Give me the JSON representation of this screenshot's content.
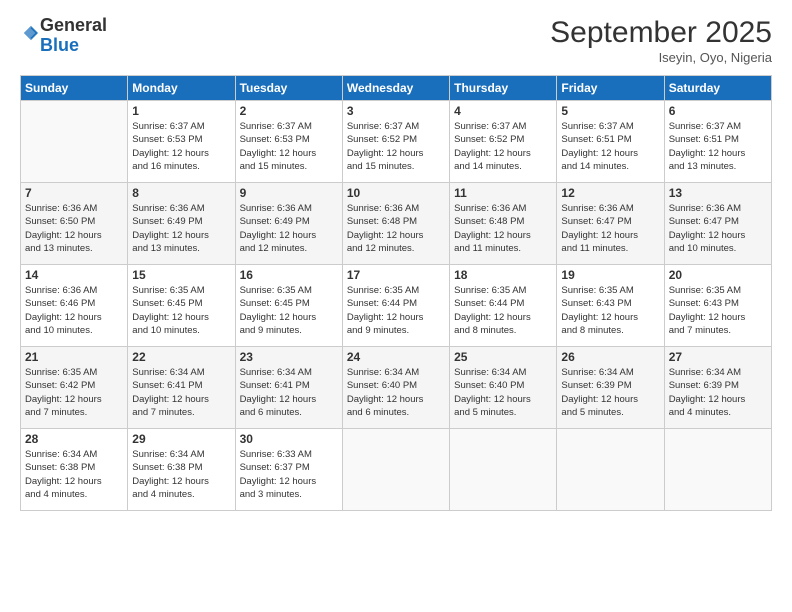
{
  "logo": {
    "general": "General",
    "blue": "Blue"
  },
  "header": {
    "month": "September 2025",
    "location": "Iseyin, Oyo, Nigeria"
  },
  "weekdays": [
    "Sunday",
    "Monday",
    "Tuesday",
    "Wednesday",
    "Thursday",
    "Friday",
    "Saturday"
  ],
  "weeks": [
    [
      {
        "day": "",
        "info": ""
      },
      {
        "day": "1",
        "info": "Sunrise: 6:37 AM\nSunset: 6:53 PM\nDaylight: 12 hours\nand 16 minutes."
      },
      {
        "day": "2",
        "info": "Sunrise: 6:37 AM\nSunset: 6:53 PM\nDaylight: 12 hours\nand 15 minutes."
      },
      {
        "day": "3",
        "info": "Sunrise: 6:37 AM\nSunset: 6:52 PM\nDaylight: 12 hours\nand 15 minutes."
      },
      {
        "day": "4",
        "info": "Sunrise: 6:37 AM\nSunset: 6:52 PM\nDaylight: 12 hours\nand 14 minutes."
      },
      {
        "day": "5",
        "info": "Sunrise: 6:37 AM\nSunset: 6:51 PM\nDaylight: 12 hours\nand 14 minutes."
      },
      {
        "day": "6",
        "info": "Sunrise: 6:37 AM\nSunset: 6:51 PM\nDaylight: 12 hours\nand 13 minutes."
      }
    ],
    [
      {
        "day": "7",
        "info": "Sunrise: 6:36 AM\nSunset: 6:50 PM\nDaylight: 12 hours\nand 13 minutes."
      },
      {
        "day": "8",
        "info": "Sunrise: 6:36 AM\nSunset: 6:49 PM\nDaylight: 12 hours\nand 13 minutes."
      },
      {
        "day": "9",
        "info": "Sunrise: 6:36 AM\nSunset: 6:49 PM\nDaylight: 12 hours\nand 12 minutes."
      },
      {
        "day": "10",
        "info": "Sunrise: 6:36 AM\nSunset: 6:48 PM\nDaylight: 12 hours\nand 12 minutes."
      },
      {
        "day": "11",
        "info": "Sunrise: 6:36 AM\nSunset: 6:48 PM\nDaylight: 12 hours\nand 11 minutes."
      },
      {
        "day": "12",
        "info": "Sunrise: 6:36 AM\nSunset: 6:47 PM\nDaylight: 12 hours\nand 11 minutes."
      },
      {
        "day": "13",
        "info": "Sunrise: 6:36 AM\nSunset: 6:47 PM\nDaylight: 12 hours\nand 10 minutes."
      }
    ],
    [
      {
        "day": "14",
        "info": "Sunrise: 6:36 AM\nSunset: 6:46 PM\nDaylight: 12 hours\nand 10 minutes."
      },
      {
        "day": "15",
        "info": "Sunrise: 6:35 AM\nSunset: 6:45 PM\nDaylight: 12 hours\nand 10 minutes."
      },
      {
        "day": "16",
        "info": "Sunrise: 6:35 AM\nSunset: 6:45 PM\nDaylight: 12 hours\nand 9 minutes."
      },
      {
        "day": "17",
        "info": "Sunrise: 6:35 AM\nSunset: 6:44 PM\nDaylight: 12 hours\nand 9 minutes."
      },
      {
        "day": "18",
        "info": "Sunrise: 6:35 AM\nSunset: 6:44 PM\nDaylight: 12 hours\nand 8 minutes."
      },
      {
        "day": "19",
        "info": "Sunrise: 6:35 AM\nSunset: 6:43 PM\nDaylight: 12 hours\nand 8 minutes."
      },
      {
        "day": "20",
        "info": "Sunrise: 6:35 AM\nSunset: 6:43 PM\nDaylight: 12 hours\nand 7 minutes."
      }
    ],
    [
      {
        "day": "21",
        "info": "Sunrise: 6:35 AM\nSunset: 6:42 PM\nDaylight: 12 hours\nand 7 minutes."
      },
      {
        "day": "22",
        "info": "Sunrise: 6:34 AM\nSunset: 6:41 PM\nDaylight: 12 hours\nand 7 minutes."
      },
      {
        "day": "23",
        "info": "Sunrise: 6:34 AM\nSunset: 6:41 PM\nDaylight: 12 hours\nand 6 minutes."
      },
      {
        "day": "24",
        "info": "Sunrise: 6:34 AM\nSunset: 6:40 PM\nDaylight: 12 hours\nand 6 minutes."
      },
      {
        "day": "25",
        "info": "Sunrise: 6:34 AM\nSunset: 6:40 PM\nDaylight: 12 hours\nand 5 minutes."
      },
      {
        "day": "26",
        "info": "Sunrise: 6:34 AM\nSunset: 6:39 PM\nDaylight: 12 hours\nand 5 minutes."
      },
      {
        "day": "27",
        "info": "Sunrise: 6:34 AM\nSunset: 6:39 PM\nDaylight: 12 hours\nand 4 minutes."
      }
    ],
    [
      {
        "day": "28",
        "info": "Sunrise: 6:34 AM\nSunset: 6:38 PM\nDaylight: 12 hours\nand 4 minutes."
      },
      {
        "day": "29",
        "info": "Sunrise: 6:34 AM\nSunset: 6:38 PM\nDaylight: 12 hours\nand 4 minutes."
      },
      {
        "day": "30",
        "info": "Sunrise: 6:33 AM\nSunset: 6:37 PM\nDaylight: 12 hours\nand 3 minutes."
      },
      {
        "day": "",
        "info": ""
      },
      {
        "day": "",
        "info": ""
      },
      {
        "day": "",
        "info": ""
      },
      {
        "day": "",
        "info": ""
      }
    ]
  ]
}
